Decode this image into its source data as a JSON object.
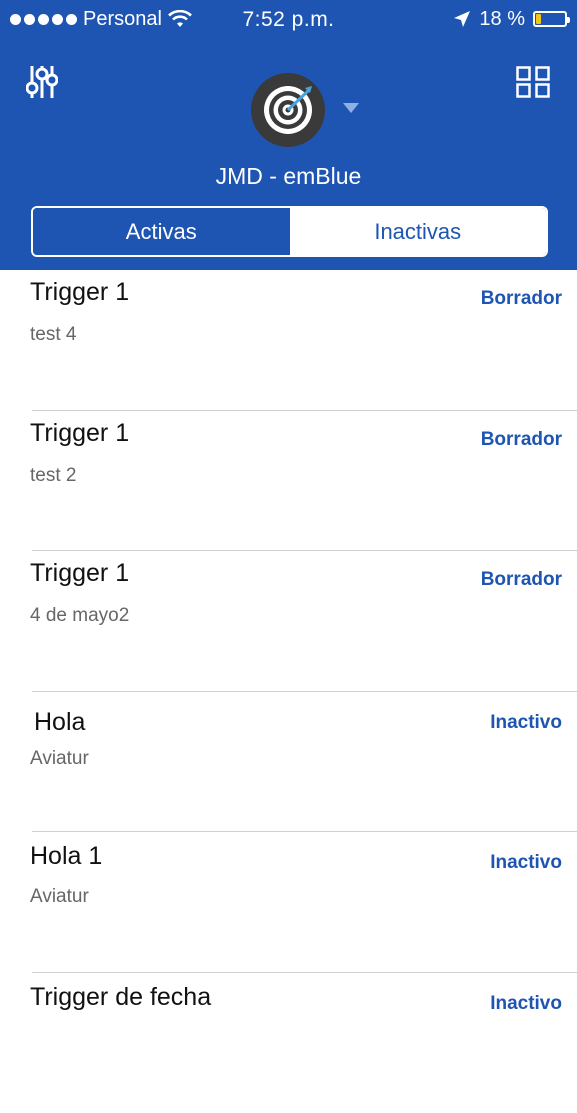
{
  "status_bar": {
    "carrier": "Personal",
    "time": "7:52 p.m.",
    "battery": "18 %",
    "battery_level": 0.18
  },
  "header": {
    "account_name": "JMD - emBlue",
    "filter_icon": "sliders-icon",
    "grid_icon": "grid-icon",
    "avatar_icon": "target-icon"
  },
  "tabs": [
    {
      "label": "Activas",
      "selected": true
    },
    {
      "label": "Inactivas",
      "selected": false
    }
  ],
  "items": [
    {
      "title": "Trigger 1",
      "subtitle": "test 4",
      "status": "Borrador"
    },
    {
      "title": "Trigger 1",
      "subtitle": "test 2",
      "status": "Borrador"
    },
    {
      "title": "Trigger 1",
      "subtitle": "4 de mayo2",
      "status": "Borrador"
    },
    {
      "title": "Hola",
      "subtitle": "Aviatur",
      "status": "Inactivo"
    },
    {
      "title": "Hola 1",
      "subtitle": "Aviatur",
      "status": "Inactivo"
    },
    {
      "title": "Trigger de fecha",
      "subtitle": "",
      "status": "Inactivo"
    }
  ],
  "colors": {
    "brand_blue": "#1e55b3",
    "battery_yellow": "#f5c518"
  }
}
